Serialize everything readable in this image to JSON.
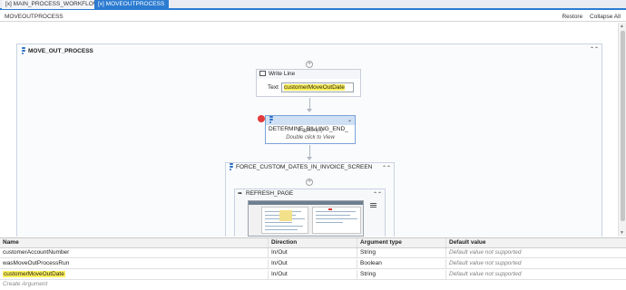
{
  "tabs": [
    {
      "label": "[x] MAIN_PROCESS_WORKFLOW *"
    },
    {
      "label": "[x] MOVEOUTPROCESS"
    }
  ],
  "header": {
    "breadcrumb": "MOVEOUTPROCESS",
    "restore_label": "Restore",
    "collapse_all_label": "Collapse All"
  },
  "workflow": {
    "outer_title": "MOVE_OUT_PROCESS",
    "write_line": {
      "title": "Write Line",
      "text_label": "Text",
      "text_value": "customerMoveOutDate"
    },
    "determine": {
      "title": "DETERMINE_BILLING_END_",
      "actions": "3 action(s)",
      "hint": "Double click to View"
    },
    "force_title": "FORCE_CUSTOM_DATES_IN_INVOICE_SCREEN",
    "refresh_title": "REFRESH_PAGE"
  },
  "arguments": {
    "columns": [
      "Name",
      "Direction",
      "Argument type",
      "Default value"
    ],
    "rows": [
      {
        "name": "customerAccountNumber",
        "direction": "In/Out",
        "type": "String",
        "default": "Default value not supported"
      },
      {
        "name": "wasMoveOutProcessRun",
        "direction": "In/Out",
        "type": "Boolean",
        "default": "Default value not supported"
      },
      {
        "name": "customerMoveOutDate",
        "direction": "In/Out",
        "type": "String",
        "default": "Default value not supported"
      }
    ],
    "create_label": "Create Argument"
  },
  "colors": {
    "accent": "#2b7bd1",
    "highlight": "#fff15a",
    "breakpoint": "#e23b3b"
  }
}
